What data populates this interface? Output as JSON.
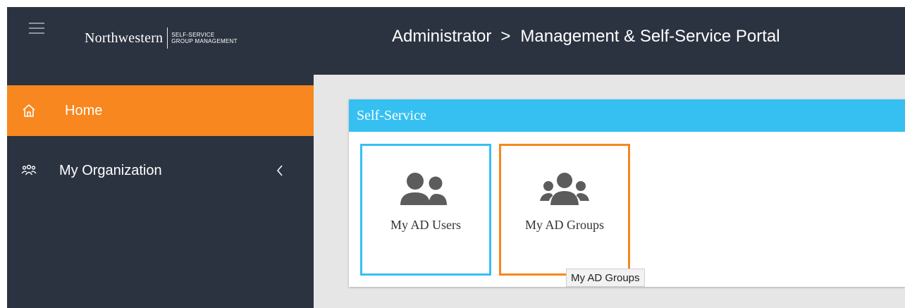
{
  "header": {
    "logo_name": "Northwestern",
    "logo_subtitle_line1": "SELF-SERVICE",
    "logo_subtitle_line2": "GROUP MANAGEMENT",
    "breadcrumb_root": "Administrator",
    "breadcrumb_separator": ">",
    "breadcrumb_current": "Management & Self-Service Portal"
  },
  "sidebar": {
    "items": [
      {
        "label": "Home",
        "icon": "home-icon",
        "active": true
      },
      {
        "label": "My Organization",
        "icon": "people-icon",
        "expand_icon": "chevron-left-icon"
      }
    ]
  },
  "panel": {
    "title": "Self-Service",
    "tiles": [
      {
        "label": "My AD Users",
        "icon": "users-icon",
        "border_color": "#36c0f1"
      },
      {
        "label": "My AD Groups",
        "icon": "groups-icon",
        "border_color": "#f7871e"
      }
    ]
  },
  "tooltip": {
    "text": "My AD Groups"
  },
  "colors": {
    "header_bg": "#2c3340",
    "active_nav": "#f7871e",
    "panel_header": "#36c0f1",
    "content_bg": "#e6e6e6"
  }
}
